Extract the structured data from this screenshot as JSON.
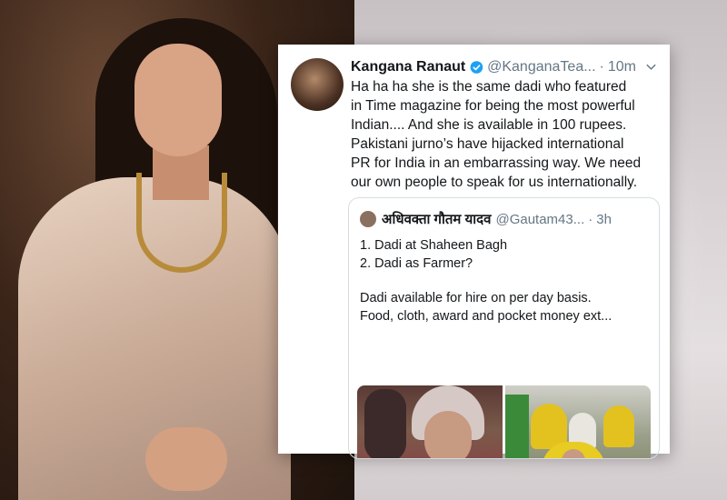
{
  "colors": {
    "verified": "#1da1f2",
    "text": "#14171a",
    "muted": "#657786",
    "border": "#d5dde2"
  },
  "tweet": {
    "author_name": "Kangana Ranaut",
    "handle": "@KanganaTea...",
    "separator": "·",
    "time": "10m",
    "verified_icon": "verified-badge-icon",
    "menu_icon": "chevron-down-icon",
    "text_lines": [
      "Ha ha ha she is the same dadi who featured",
      "in Time magazine for being the most powerful",
      "Indian.... And she is available in 100 rupees.",
      "Pakistani jurno’s have hijacked international",
      "PR for India in an embarrassing way. We need",
      "our own people to speak for us internationally."
    ]
  },
  "quoted_tweet": {
    "author_name": "अधिवक्ता गौतम यादव",
    "handle": "@Gautam43...",
    "separator": "·",
    "time": "3h",
    "lines": [
      "1. Dadi at Shaheen Bagh",
      "2. Dadi as Farmer?",
      "",
      "Dadi available for hire on per day basis.",
      "Food, cloth, award and pocket money ext..."
    ]
  }
}
